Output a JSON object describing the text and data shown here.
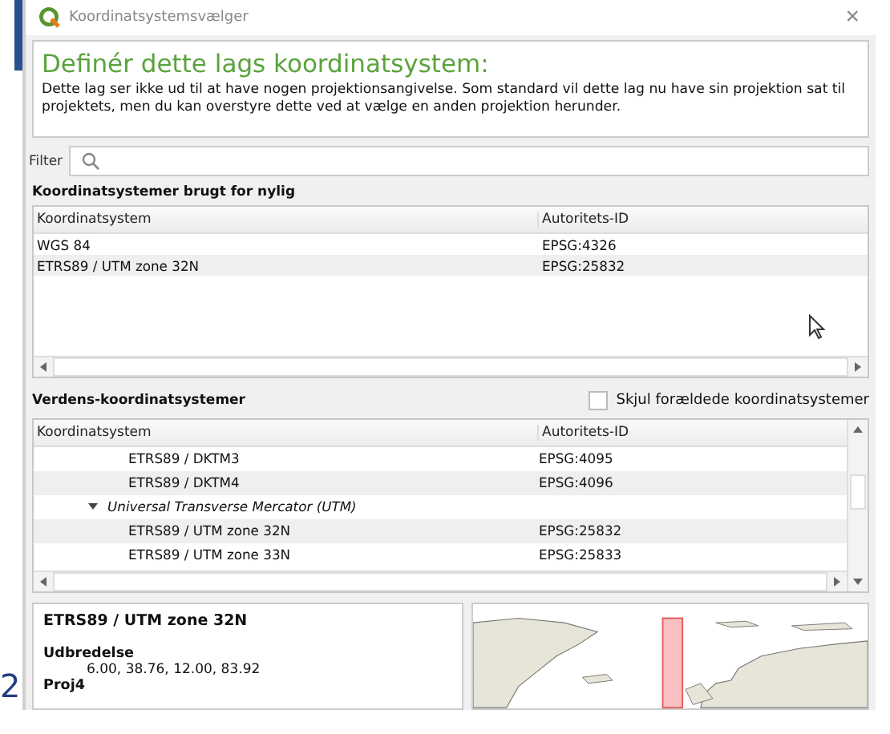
{
  "window": {
    "title": "Koordinatsystemsvælger",
    "close": "×"
  },
  "message": {
    "heading": "Definér dette lags koordinatsystem:",
    "text": "Dette lag ser ikke ud til at have nogen projektionsangivelse. Som standard vil dette lag nu have sin projektion sat til projektets, men du kan overstyre dette ved at vælge en anden projektion herunder."
  },
  "filter": {
    "label": "Filter"
  },
  "recent": {
    "title": "Koordinatsystemer brugt for nylig",
    "columns": [
      "Koordinatsystem",
      "Autoritets-ID"
    ],
    "rows": [
      {
        "name": "WGS 84",
        "id": "EPSG:4326"
      },
      {
        "name": "ETRS89 / UTM zone 32N",
        "id": "EPSG:25832"
      }
    ]
  },
  "world": {
    "title": "Verdens-koordinatsystemer",
    "hide_deprecated": {
      "label": "Skjul forældede koordinatsystemer",
      "checked": false
    },
    "columns": [
      "Koordinatsystem",
      "Autoritets-ID"
    ],
    "rows": [
      {
        "kind": "item",
        "name": "ETRS89 / DKTM3",
        "id": "EPSG:4095"
      },
      {
        "kind": "item",
        "name": "ETRS89 / DKTM4",
        "id": "EPSG:4096"
      },
      {
        "kind": "group",
        "name": "Universal Transverse Mercator (UTM)",
        "expanded": true,
        "children": [
          {
            "kind": "item",
            "name": "ETRS89 / UTM zone 32N",
            "id": "EPSG:25832"
          },
          {
            "kind": "item",
            "name": "ETRS89 / UTM zone 33N",
            "id": "EPSG:25833"
          }
        ]
      }
    ]
  },
  "details": {
    "title": "ETRS89 / UTM zone 32N",
    "sections": [
      {
        "label": "Udbredelse",
        "value": "6.00, 38.76, 12.00, 83.92"
      },
      {
        "label": "Proj4"
      }
    ]
  },
  "background_text": "2"
}
